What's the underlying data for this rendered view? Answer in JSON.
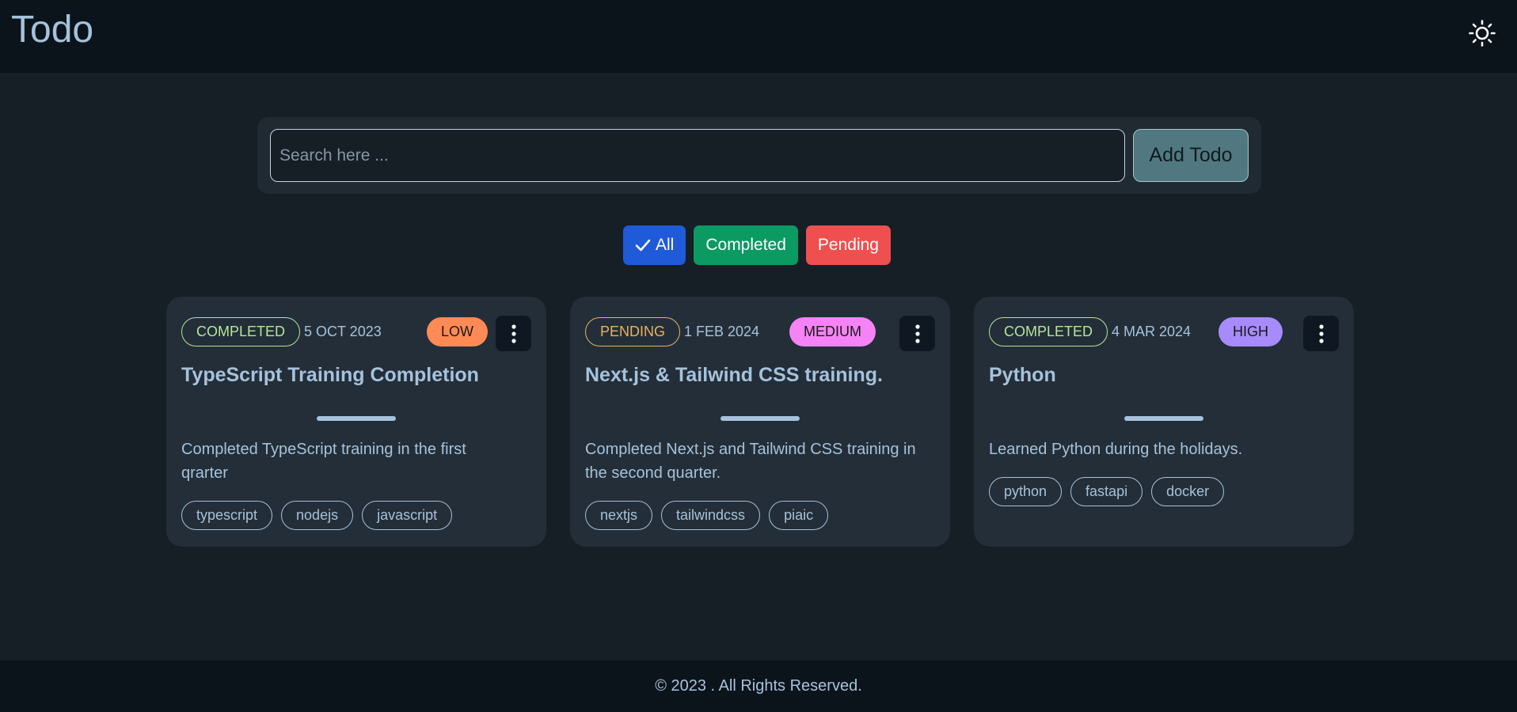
{
  "app": {
    "title": "Todo"
  },
  "header": {
    "theme_icon": "sun-icon"
  },
  "search": {
    "placeholder": "Search here ...",
    "value": ""
  },
  "toolbar": {
    "add_label": "Add Todo"
  },
  "filters": [
    {
      "label": "All",
      "active": true,
      "color": "#1f5ad9",
      "icon": "check-icon"
    },
    {
      "label": "Completed",
      "active": false,
      "color": "#0c9a63"
    },
    {
      "label": "Pending",
      "active": false,
      "color": "#ef4f4f"
    }
  ],
  "todos": [
    {
      "status": "COMPLETED",
      "status_color": "#b4e69a",
      "date": "5 OCT 2023",
      "priority": "LOW",
      "priority_color": "#ff8a55",
      "title": "TypeScript Training Completion",
      "description": "Completed TypeScript training in the first qrarter",
      "tags": [
        "typescript",
        "nodejs",
        "javascript"
      ]
    },
    {
      "status": "PENDING",
      "status_color": "#e9b25e",
      "date": "1 FEB 2024",
      "priority": "MEDIUM",
      "priority_color": "#f683f6",
      "title": "Next.js & Tailwind CSS training.",
      "description": "Completed Next.js and Tailwind CSS training in the second quarter.",
      "tags": [
        "nextjs",
        "tailwindcss",
        "piaic"
      ]
    },
    {
      "status": "COMPLETED",
      "status_color": "#b4e69a",
      "date": "4 MAR 2024",
      "priority": "HIGH",
      "priority_color": "#a78bfa",
      "title": "Python",
      "description": "Learned Python during the holidays.",
      "tags": [
        "python",
        "fastapi",
        "docker"
      ]
    }
  ],
  "footer": {
    "text": "© 2023 . All Rights Reserved."
  }
}
